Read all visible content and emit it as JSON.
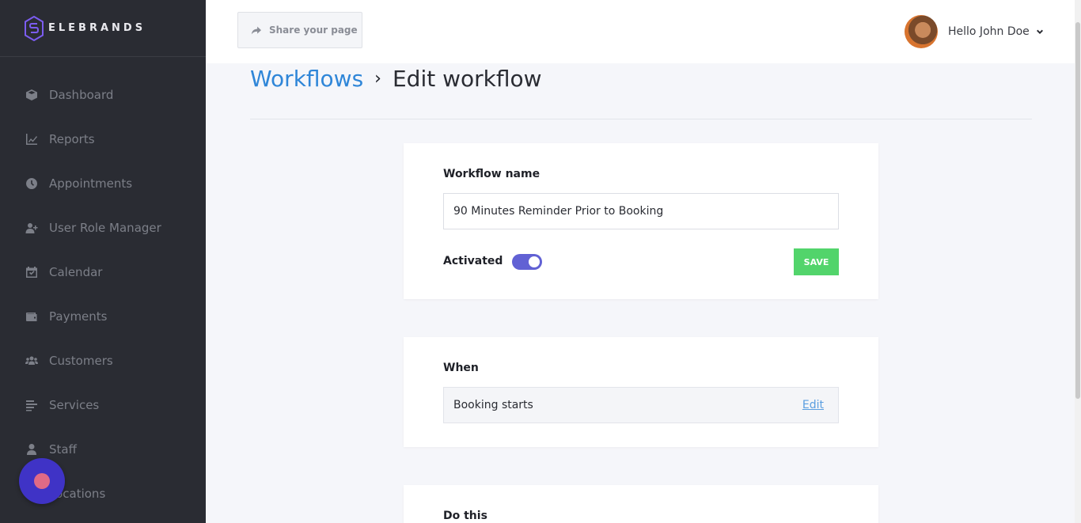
{
  "brand": {
    "name": "ELEBRANDS"
  },
  "sidebar": {
    "items": [
      {
        "label": "Dashboard",
        "icon": "cube-icon"
      },
      {
        "label": "Reports",
        "icon": "chart-line-icon"
      },
      {
        "label": "Appointments",
        "icon": "clock-icon"
      },
      {
        "label": "User Role Manager",
        "icon": "user-plus-icon"
      },
      {
        "label": "Calendar",
        "icon": "calendar-check-icon"
      },
      {
        "label": "Payments",
        "icon": "wallet-icon"
      },
      {
        "label": "Customers",
        "icon": "users-icon"
      },
      {
        "label": "Services",
        "icon": "list-icon"
      },
      {
        "label": "Staff",
        "icon": "user-icon"
      },
      {
        "label": "Locations",
        "icon": "map-marker-icon"
      }
    ]
  },
  "header": {
    "share_label": "Share your page",
    "user_greeting": "Hello John Doe"
  },
  "breadcrumb": {
    "parent": "Workflows",
    "separator": "›",
    "current": "Edit workflow"
  },
  "workflow": {
    "name_label": "Workflow name",
    "name_value": "90 Minutes Reminder Prior to Booking",
    "activated_label": "Activated",
    "activated": true,
    "save_label": "SAVE"
  },
  "when": {
    "label": "When",
    "trigger": "Booking starts",
    "edit_label": "Edit"
  },
  "do_this": {
    "label": "Do this"
  },
  "colors": {
    "sidebar_bg": "#2a2c33",
    "accent_link": "#2f86d8",
    "toggle_on": "#6161d4",
    "save_green": "#52d46b",
    "chat_bubble": "#3f33c6"
  }
}
